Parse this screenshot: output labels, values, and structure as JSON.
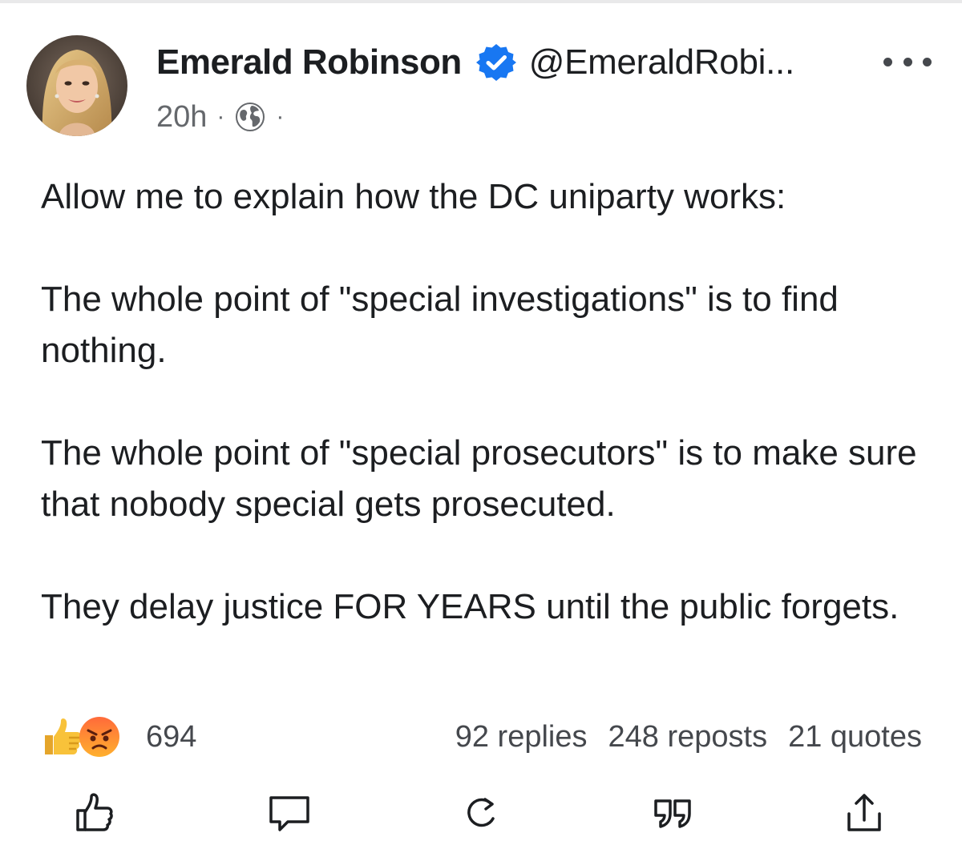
{
  "post": {
    "author": {
      "name": "Emerald Robinson",
      "handle": "@EmeraldRobi...",
      "verified": true,
      "verified_color": "#1877f2"
    },
    "meta": {
      "time": "20h",
      "separator": "·",
      "audience_icon": "globe-icon"
    },
    "paragraphs": [
      "Allow me to explain how the DC uniparty works:",
      "The whole point of \"special investigations\" is to find nothing.",
      "The whole point of \"special prosecutors\" is to make sure that nobody special gets prosecuted.",
      "They delay justice FOR YEARS until the public forgets."
    ],
    "reactions": {
      "icons": [
        "like-reaction-icon",
        "angry-reaction-icon"
      ],
      "count": "694"
    },
    "stats": {
      "replies": "92 replies",
      "reposts": "248 reposts",
      "quotes": "21 quotes"
    },
    "actions": [
      "like-button",
      "comment-button",
      "repost-button",
      "quote-button",
      "share-button"
    ]
  }
}
